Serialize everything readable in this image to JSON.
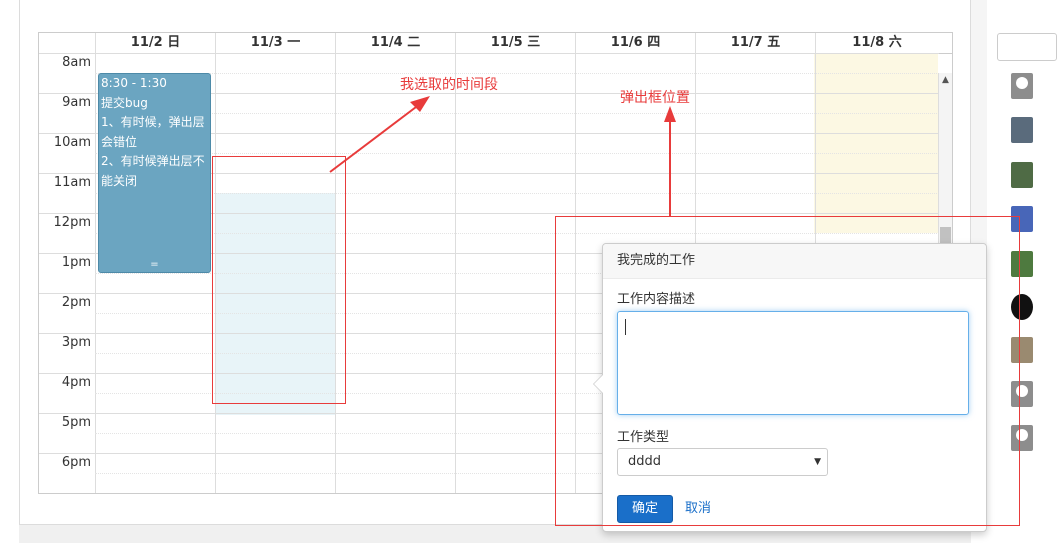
{
  "calendar": {
    "days": [
      "11/2 日",
      "11/3 一",
      "11/4 二",
      "11/5 三",
      "11/6 四",
      "11/7 五",
      "11/8 六"
    ],
    "hours": [
      "8am",
      "9am",
      "10am",
      "11am",
      "12pm",
      "1pm",
      "2pm",
      "3pm",
      "4pm",
      "5pm",
      "6pm"
    ],
    "event": {
      "time": "8:30 - 1:30",
      "lines": [
        "提交bug",
        "1、有时候，弹出层",
        "会错位",
        "2、有时候弹出层不",
        "能关闭"
      ],
      "resize_handle": "="
    }
  },
  "popover": {
    "title": "我完成的工作",
    "description_label": "工作内容描述",
    "description_value": "",
    "type_label": "工作类型",
    "type_value": "dddd",
    "ok_label": "确定",
    "cancel_label": "取消"
  },
  "annotations": {
    "selected_range": "我选取的时间段",
    "popup_position": "弹出框位置"
  },
  "colors": {
    "event_bg": "#6ba5c1",
    "selection_bg": "#e8f4f8",
    "today_bg": "#fcf8e3",
    "annotation": "#e83b3b",
    "primary_button": "#1a6fc9"
  }
}
